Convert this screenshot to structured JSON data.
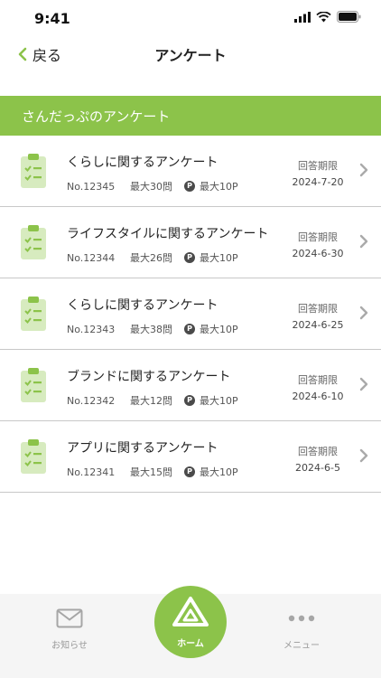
{
  "status": {
    "time": "9:41"
  },
  "nav": {
    "back_label": "戻る",
    "title": "アンケート"
  },
  "section": {
    "title": "さんだっぷのアンケート"
  },
  "surveys": [
    {
      "title": "くらしに関するアンケート",
      "number": "No.12345",
      "questions": "最大30問",
      "points": "最大10P",
      "deadline_label": "回答期限",
      "deadline": "2024-7-20"
    },
    {
      "title": "ライフスタイルに関するアンケート",
      "number": "No.12344",
      "questions": "最大26問",
      "points": "最大10P",
      "deadline_label": "回答期限",
      "deadline": "2024-6-30"
    },
    {
      "title": "くらしに関するアンケート",
      "number": "No.12343",
      "questions": "最大38問",
      "points": "最大10P",
      "deadline_label": "回答期限",
      "deadline": "2024-6-25"
    },
    {
      "title": "ブランドに関するアンケート",
      "number": "No.12342",
      "questions": "最大12問",
      "points": "最大10P",
      "deadline_label": "回答期限",
      "deadline": "2024-6-10"
    },
    {
      "title": "アプリに関するアンケート",
      "number": "No.12341",
      "questions": "最大15問",
      "points": "最大10P",
      "deadline_label": "回答期限",
      "deadline": "2024-6-5"
    }
  ],
  "point_badge": "P",
  "tabbar": {
    "news_label": "お知らせ",
    "home_label": "ホーム",
    "menu_label": "メニュー"
  },
  "colors": {
    "accent": "#8cc34a",
    "icon_bg": "#d7ebbf"
  }
}
